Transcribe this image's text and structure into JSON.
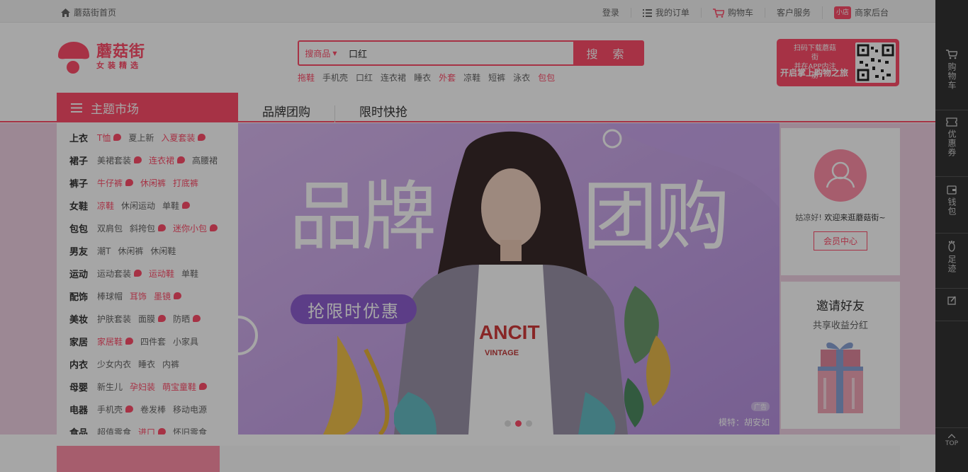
{
  "colors": {
    "brand": "#ff4d6a",
    "sidebar": "#333333",
    "banner_bg": "#c5a3e7"
  },
  "topbar": {
    "home_label": "蘑菇街首页",
    "links": [
      {
        "label": "登录"
      },
      {
        "label": "我的订单",
        "icon": "list-icon"
      },
      {
        "label": "购物车",
        "icon": "cart-icon"
      },
      {
        "label": "客户服务"
      },
      {
        "label": "商家后台",
        "badge": "小店"
      }
    ]
  },
  "logo": {
    "name": "蘑菇街",
    "slogan": "女装精选"
  },
  "search": {
    "category": "搜商品",
    "value": "口红",
    "button": "搜 索"
  },
  "hot_keywords": [
    {
      "label": "拖鞋",
      "hl": true
    },
    {
      "label": "手机壳",
      "hl": false
    },
    {
      "label": "口红",
      "hl": false
    },
    {
      "label": "连衣裙",
      "hl": false
    },
    {
      "label": "睡衣",
      "hl": false
    },
    {
      "label": "外套",
      "hl": true
    },
    {
      "label": "凉鞋",
      "hl": false
    },
    {
      "label": "短裤",
      "hl": false
    },
    {
      "label": "泳衣",
      "hl": false
    },
    {
      "label": "包包",
      "hl": true
    }
  ],
  "app_promo": {
    "line1": "扫码下载蘑菇街",
    "line2": "并在APP内注册",
    "line3": "开启掌上购物之旅"
  },
  "nav": {
    "menu_title": "主题市场",
    "tabs": [
      "品牌团购",
      "限时快抢"
    ]
  },
  "categories": [
    {
      "head": "上衣",
      "items": [
        {
          "t": "T恤",
          "hl": true,
          "dot": true
        },
        {
          "t": "夏上新",
          "hl": false,
          "dot": false
        },
        {
          "t": "入夏套装",
          "hl": true,
          "dot": true
        }
      ]
    },
    {
      "head": "裙子",
      "items": [
        {
          "t": "美裙套装",
          "hl": false,
          "dot": true
        },
        {
          "t": "连衣裙",
          "hl": true,
          "dot": true
        },
        {
          "t": "高腰裙",
          "hl": false,
          "dot": false
        }
      ]
    },
    {
      "head": "裤子",
      "items": [
        {
          "t": "牛仔裤",
          "hl": true,
          "dot": true
        },
        {
          "t": "休闲裤",
          "hl": true,
          "dot": false
        },
        {
          "t": "打底裤",
          "hl": true,
          "dot": false
        }
      ]
    },
    {
      "head": "女鞋",
      "items": [
        {
          "t": "凉鞋",
          "hl": true,
          "dot": false
        },
        {
          "t": "休闲运动",
          "hl": false,
          "dot": false
        },
        {
          "t": "单鞋",
          "hl": false,
          "dot": true
        }
      ]
    },
    {
      "head": "包包",
      "items": [
        {
          "t": "双肩包",
          "hl": false,
          "dot": false
        },
        {
          "t": "斜挎包",
          "hl": false,
          "dot": true
        },
        {
          "t": "迷你小包",
          "hl": true,
          "dot": true
        }
      ]
    },
    {
      "head": "男友",
      "items": [
        {
          "t": "潮T",
          "hl": false,
          "dot": false
        },
        {
          "t": "休闲裤",
          "hl": false,
          "dot": false
        },
        {
          "t": "休闲鞋",
          "hl": false,
          "dot": false
        }
      ]
    },
    {
      "head": "运动",
      "items": [
        {
          "t": "运动套装",
          "hl": false,
          "dot": true
        },
        {
          "t": "运动鞋",
          "hl": true,
          "dot": false
        },
        {
          "t": "单鞋",
          "hl": false,
          "dot": false
        }
      ]
    },
    {
      "head": "配饰",
      "items": [
        {
          "t": "棒球帽",
          "hl": false,
          "dot": false
        },
        {
          "t": "耳饰",
          "hl": true,
          "dot": false
        },
        {
          "t": "墨镜",
          "hl": true,
          "dot": true
        }
      ]
    },
    {
      "head": "美妆",
      "items": [
        {
          "t": "护肤套装",
          "hl": false,
          "dot": false
        },
        {
          "t": "面膜",
          "hl": false,
          "dot": true
        },
        {
          "t": "防晒",
          "hl": false,
          "dot": true
        }
      ]
    },
    {
      "head": "家居",
      "items": [
        {
          "t": "家居鞋",
          "hl": true,
          "dot": true
        },
        {
          "t": "四件套",
          "hl": false,
          "dot": false
        },
        {
          "t": "小家具",
          "hl": false,
          "dot": false
        }
      ]
    },
    {
      "head": "内衣",
      "items": [
        {
          "t": "少女内衣",
          "hl": false,
          "dot": false
        },
        {
          "t": "睡衣",
          "hl": false,
          "dot": false
        },
        {
          "t": "内裤",
          "hl": false,
          "dot": false
        }
      ]
    },
    {
      "head": "母婴",
      "items": [
        {
          "t": "新生儿",
          "hl": false,
          "dot": false
        },
        {
          "t": "孕妇装",
          "hl": true,
          "dot": false
        },
        {
          "t": "萌宝童鞋",
          "hl": true,
          "dot": true
        }
      ]
    },
    {
      "head": "电器",
      "items": [
        {
          "t": "手机壳",
          "hl": false,
          "dot": true
        },
        {
          "t": "卷发棒",
          "hl": false,
          "dot": false
        },
        {
          "t": "移动电源",
          "hl": false,
          "dot": false
        }
      ]
    },
    {
      "head": "食品",
      "items": [
        {
          "t": "超值零食",
          "hl": false,
          "dot": false
        },
        {
          "t": "进口",
          "hl": true,
          "dot": true
        },
        {
          "t": "怀旧零食",
          "hl": false,
          "dot": false
        }
      ]
    }
  ],
  "banner": {
    "title_left": "品牌",
    "title_right": "团购",
    "promo": "抢限时优惠",
    "tshirt_brand": "ANCIT",
    "tshirt_tag": "VINTAGE",
    "ad_tag": "广告",
    "credit": "模特：胡安如",
    "slides": 3,
    "active_slide": 2
  },
  "user": {
    "greet_1": "姑凉好!",
    "greet_2": "欢迎来逛蘑菇街~",
    "member_button": "会员中心"
  },
  "invite": {
    "title": "邀请好友",
    "subtitle": "共享收益分红"
  },
  "sidebar": {
    "items": [
      {
        "label": "购物车",
        "icon": "cart-icon"
      },
      {
        "label": "优惠券",
        "icon": "coupon-icon"
      },
      {
        "label": "钱包",
        "icon": "wallet-icon"
      },
      {
        "label": "足迹",
        "icon": "footprint-icon"
      },
      {
        "label": "",
        "icon": "feedback-icon"
      }
    ],
    "top_label": "TOP"
  }
}
